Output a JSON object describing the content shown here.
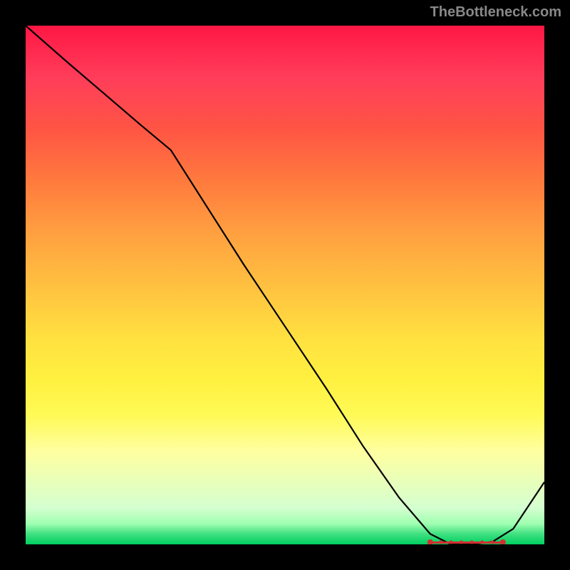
{
  "watermark": "TheBottleneck.com",
  "chart_data": {
    "type": "line",
    "title": "",
    "xlabel": "",
    "ylabel": "",
    "xlim": [
      0,
      100
    ],
    "ylim": [
      0,
      100
    ],
    "series": [
      {
        "name": "bottleneck-curve",
        "x": [
          0,
          8,
          15,
          22,
          28,
          35,
          42,
          50,
          58,
          65,
          72,
          78,
          82,
          86,
          90,
          94,
          100
        ],
        "values": [
          100,
          93,
          87,
          81,
          76,
          65,
          54,
          42,
          30,
          19,
          9,
          2,
          0,
          0,
          0.5,
          3,
          12
        ]
      }
    ],
    "markers": {
      "name": "optimal-range",
      "x_start": 78,
      "x_end": 92,
      "y": 0
    },
    "gradient_stops": [
      {
        "pos": 0,
        "color": "#ff1744"
      },
      {
        "pos": 50,
        "color": "#ffc040"
      },
      {
        "pos": 80,
        "color": "#ffffa0"
      },
      {
        "pos": 100,
        "color": "#00d060"
      }
    ]
  }
}
